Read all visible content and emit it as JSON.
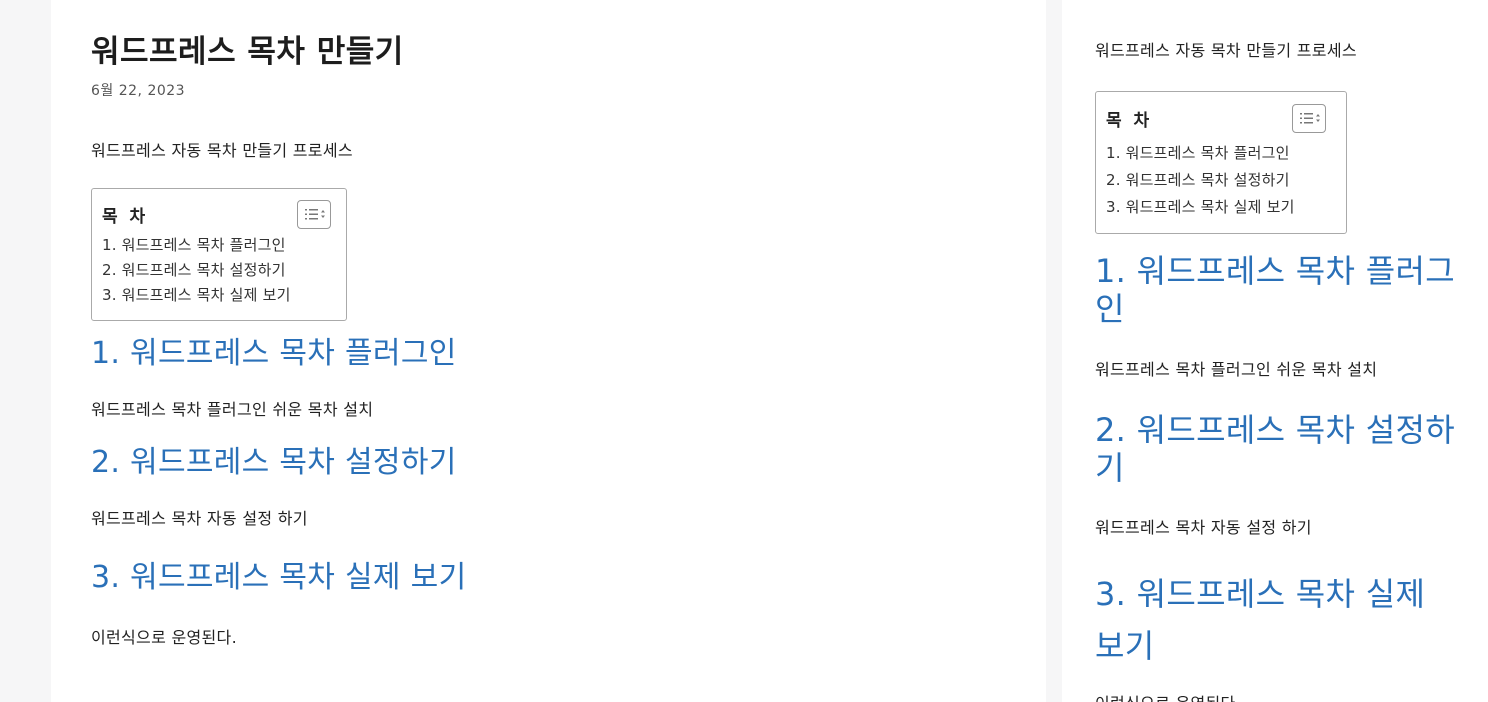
{
  "post": {
    "title": "워드프레스 목차 만들기",
    "date": "6월 22, 2023",
    "intro": "워드프레스 자동 목차 만들기 프로세스"
  },
  "toc": {
    "title": "목 차",
    "toggle_icon": "list-toggle-icon",
    "items": [
      "1. 워드프레스 목차 플러그인",
      "2. 워드프레스 목차 설정하기",
      "3. 워드프레스 목차 실제 보기"
    ]
  },
  "sections": [
    {
      "heading": "1. 워드프레스 목차 플러그인",
      "text": "워드프레스 목차 플러그인 쉬운 목차 설치"
    },
    {
      "heading": "2. 워드프레스 목차 설정하기",
      "text": "워드프레스 목차 자동 설정 하기"
    },
    {
      "heading": "3. 워드프레스 목차 실제 보기",
      "text": "이런식으로 운영된다."
    }
  ],
  "colors": {
    "heading_link": "#2a70b8",
    "page_background": "#f6f6f7",
    "card_background": "#ffffff"
  }
}
